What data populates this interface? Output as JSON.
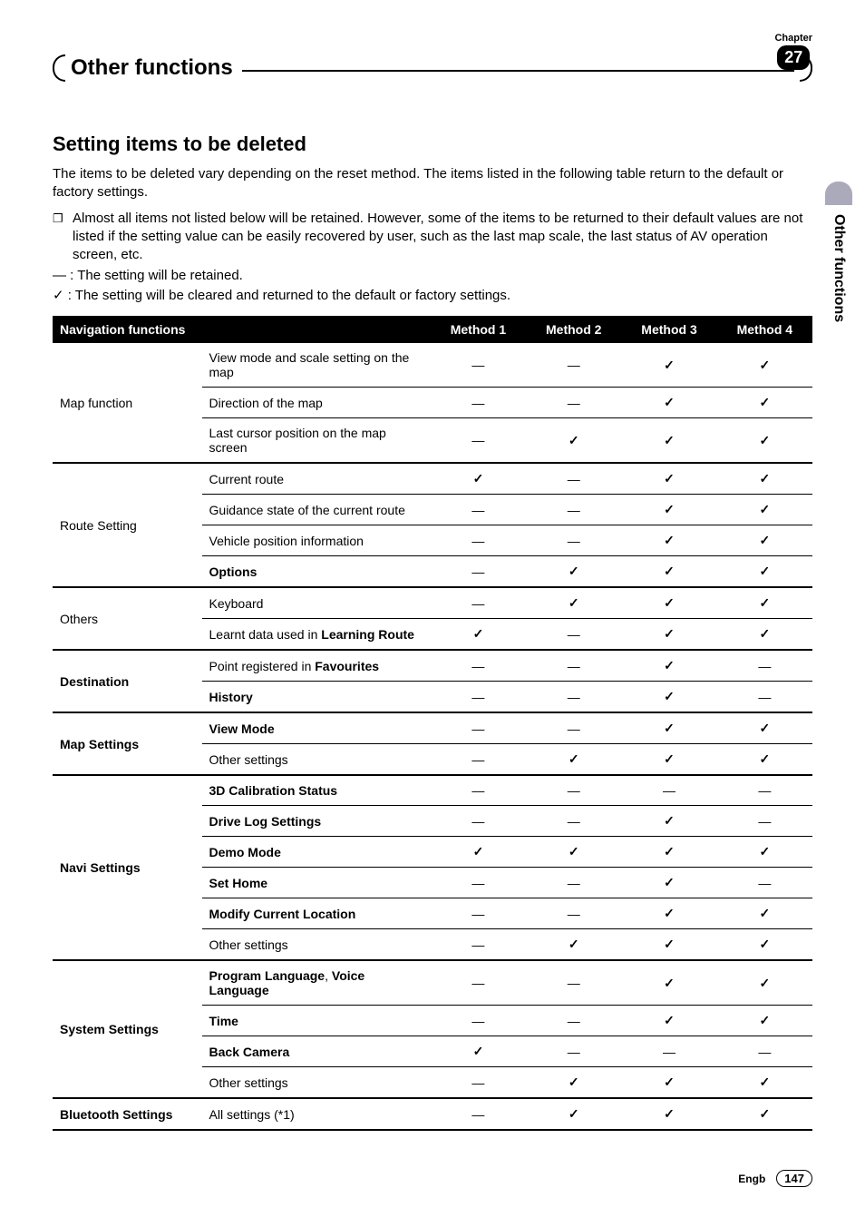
{
  "chapter": {
    "label": "Chapter",
    "number": "27"
  },
  "page_title": "Other functions",
  "side_tab": "Other functions",
  "section_heading": "Setting items to be deleted",
  "intro": "The items to be deleted vary depending on the reset method. The items listed in the following table return to the default or factory settings.",
  "note": "Almost all items not listed below will be retained. However, some of the items to be returned to their default values are not listed if the setting value can be easily recovered by user, such as the last map scale, the last status of AV operation screen, etc.",
  "legend_dash": "— : The setting will be retained.",
  "legend_check": "✓ : The setting will be cleared and returned to the default or factory settings.",
  "table_header": {
    "nav": "Navigation functions",
    "m1": "Method 1",
    "m2": "Method 2",
    "m3": "Method 3",
    "m4": "Method 4"
  },
  "groups": [
    {
      "label": "Map function",
      "bold": false,
      "rows": [
        {
          "item": "View mode and scale setting on the map",
          "bold": false,
          "m": [
            "—",
            "—",
            "✓",
            "✓"
          ]
        },
        {
          "item": "Direction of the map",
          "bold": false,
          "m": [
            "—",
            "—",
            "✓",
            "✓"
          ]
        },
        {
          "item": "Last cursor position on the map screen",
          "bold": false,
          "m": [
            "—",
            "✓",
            "✓",
            "✓"
          ]
        }
      ]
    },
    {
      "label": "Route Setting",
      "bold": false,
      "rows": [
        {
          "item": "Current route",
          "bold": false,
          "m": [
            "✓",
            "—",
            "✓",
            "✓"
          ]
        },
        {
          "item": "Guidance state of the current route",
          "bold": false,
          "m": [
            "—",
            "—",
            "✓",
            "✓"
          ]
        },
        {
          "item": "Vehicle position information",
          "bold": false,
          "m": [
            "—",
            "—",
            "✓",
            "✓"
          ]
        },
        {
          "item": "Options",
          "bold": true,
          "m": [
            "—",
            "✓",
            "✓",
            "✓"
          ]
        }
      ]
    },
    {
      "label": "Others",
      "bold": false,
      "rows": [
        {
          "item": "Keyboard",
          "bold": false,
          "m": [
            "—",
            "✓",
            "✓",
            "✓"
          ]
        },
        {
          "item_html": "Learnt data used in <b>Learning Route</b>",
          "bold": false,
          "m": [
            "✓",
            "—",
            "✓",
            "✓"
          ]
        }
      ]
    },
    {
      "label": "Destination",
      "bold": true,
      "rows": [
        {
          "item_html": "Point registered in <b>Favourites</b>",
          "bold": false,
          "m": [
            "—",
            "—",
            "✓",
            "—"
          ]
        },
        {
          "item": "History",
          "bold": true,
          "m": [
            "—",
            "—",
            "✓",
            "—"
          ]
        }
      ]
    },
    {
      "label": "Map Settings",
      "bold": true,
      "rows": [
        {
          "item": "View Mode",
          "bold": true,
          "m": [
            "—",
            "—",
            "✓",
            "✓"
          ]
        },
        {
          "item": "Other settings",
          "bold": false,
          "m": [
            "—",
            "✓",
            "✓",
            "✓"
          ]
        }
      ]
    },
    {
      "label": "Navi Settings",
      "bold": true,
      "rows": [
        {
          "item": "3D Calibration Status",
          "bold": true,
          "m": [
            "—",
            "—",
            "—",
            "—"
          ]
        },
        {
          "item": "Drive Log Settings",
          "bold": true,
          "m": [
            "—",
            "—",
            "✓",
            "—"
          ]
        },
        {
          "item": "Demo Mode",
          "bold": true,
          "m": [
            "✓",
            "✓",
            "✓",
            "✓"
          ]
        },
        {
          "item": "Set Home",
          "bold": true,
          "m": [
            "—",
            "—",
            "✓",
            "—"
          ]
        },
        {
          "item": "Modify Current Location",
          "bold": true,
          "m": [
            "—",
            "—",
            "✓",
            "✓"
          ]
        },
        {
          "item": "Other settings",
          "bold": false,
          "m": [
            "—",
            "✓",
            "✓",
            "✓"
          ]
        }
      ]
    },
    {
      "label": "System Settings",
      "bold": true,
      "rows": [
        {
          "item_html": "<b>Program Language</b>, <b>Voice Language</b>",
          "bold": false,
          "m": [
            "—",
            "—",
            "✓",
            "✓"
          ]
        },
        {
          "item": "Time",
          "bold": true,
          "m": [
            "—",
            "—",
            "✓",
            "✓"
          ]
        },
        {
          "item": "Back Camera",
          "bold": true,
          "m": [
            "✓",
            "—",
            "—",
            "—"
          ]
        },
        {
          "item": "Other settings",
          "bold": false,
          "m": [
            "—",
            "✓",
            "✓",
            "✓"
          ]
        }
      ]
    },
    {
      "label": "Bluetooth Settings",
      "bold": true,
      "rows": [
        {
          "item": "All settings (*1)",
          "bold": false,
          "m": [
            "—",
            "✓",
            "✓",
            "✓"
          ]
        }
      ]
    }
  ],
  "footer": {
    "lang": "Engb",
    "page": "147"
  }
}
